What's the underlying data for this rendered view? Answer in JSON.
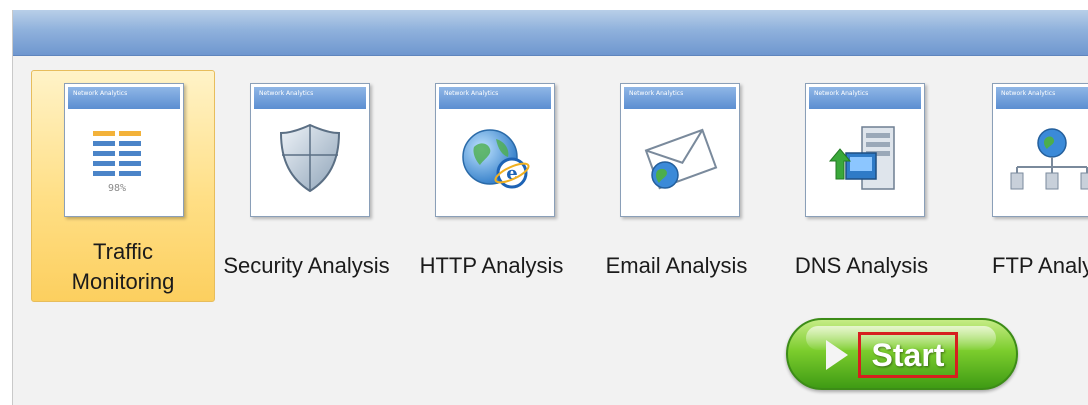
{
  "modules": [
    {
      "card_header": "Network Analytics",
      "label_line1": "Traffic",
      "label_line2": "Monitoring",
      "icon": "traffic-monitoring-icon",
      "selected": true,
      "icon_caption": "98%"
    },
    {
      "card_header": "Network Analytics",
      "label": "Security Analysis",
      "icon": "shield-icon",
      "selected": false
    },
    {
      "card_header": "Network Analytics",
      "label": "HTTP Analysis",
      "icon": "globe-ie-icon",
      "selected": false
    },
    {
      "card_header": "Network Analytics",
      "label": "Email Analysis",
      "icon": "envelope-icon",
      "selected": false
    },
    {
      "card_header": "Network Analytics",
      "label": "DNS Analysis",
      "icon": "dns-server-icon",
      "selected": false
    },
    {
      "card_header": "Network Analytics",
      "label": "FTP Analy",
      "icon": "ftp-network-icon",
      "selected": false
    }
  ],
  "start_button": {
    "label": "Start",
    "icon": "play-icon"
  },
  "colors": {
    "selected_bg": "#fcd56e",
    "titlebar": "#8fb1dc",
    "start_green": "#6cc227",
    "highlight_red": "#d61f1f"
  }
}
